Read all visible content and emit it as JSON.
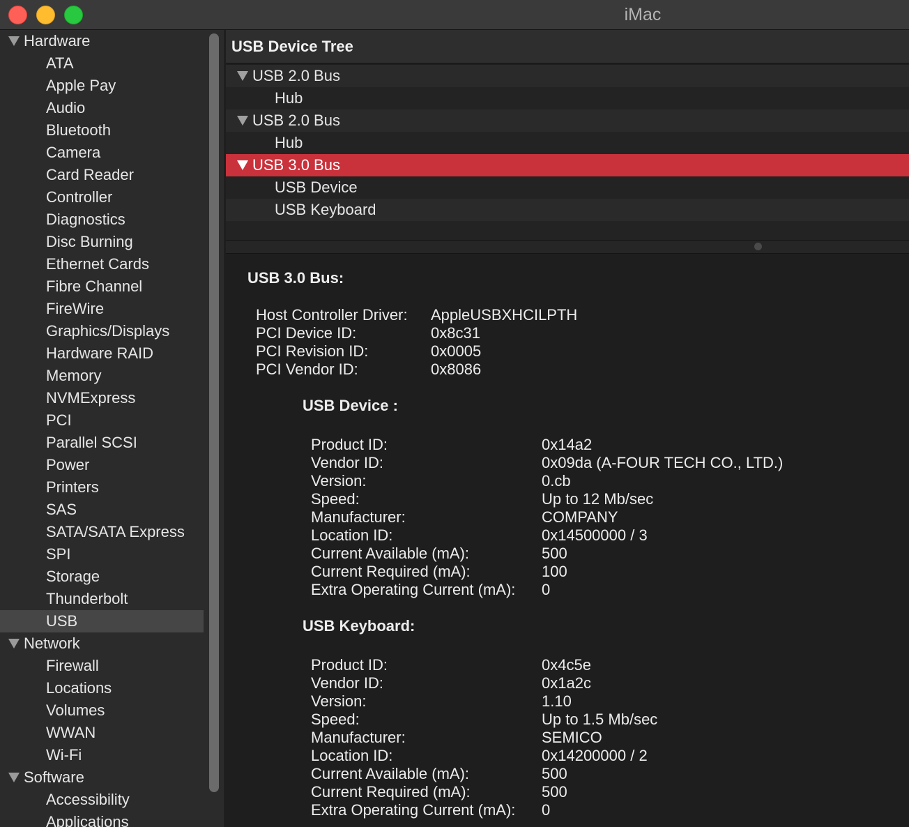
{
  "window": {
    "title": "iMac"
  },
  "sidebar": {
    "groups": [
      {
        "label": "Hardware",
        "items": [
          "ATA",
          "Apple Pay",
          "Audio",
          "Bluetooth",
          "Camera",
          "Card Reader",
          "Controller",
          "Diagnostics",
          "Disc Burning",
          "Ethernet Cards",
          "Fibre Channel",
          "FireWire",
          "Graphics/Displays",
          "Hardware RAID",
          "Memory",
          "NVMExpress",
          "PCI",
          "Parallel SCSI",
          "Power",
          "Printers",
          "SAS",
          "SATA/SATA Express",
          "SPI",
          "Storage",
          "Thunderbolt",
          "USB"
        ]
      },
      {
        "label": "Network",
        "items": [
          "Firewall",
          "Locations",
          "Volumes",
          "WWAN",
          "Wi-Fi"
        ]
      },
      {
        "label": "Software",
        "items": [
          "Accessibility",
          "Applications"
        ]
      }
    ],
    "selected": "USB"
  },
  "tree": {
    "header": "USB Device Tree",
    "rows": [
      {
        "label": "USB 2.0 Bus",
        "type": "bus"
      },
      {
        "label": "Hub",
        "type": "child"
      },
      {
        "label": "USB 2.0 Bus",
        "type": "bus"
      },
      {
        "label": "Hub",
        "type": "child"
      },
      {
        "label": "USB 3.0 Bus",
        "type": "bus",
        "selected": true
      },
      {
        "label": "USB Device",
        "type": "child"
      },
      {
        "label": "USB Keyboard",
        "type": "child"
      }
    ]
  },
  "detail": {
    "title": "USB 3.0 Bus:",
    "bus_props": [
      {
        "key": "Host Controller Driver:",
        "value": "AppleUSBXHCILPTH"
      },
      {
        "key": "PCI Device ID:",
        "value": "0x8c31"
      },
      {
        "key": "PCI Revision ID:",
        "value": "0x0005"
      },
      {
        "key": "PCI Vendor ID:",
        "value": "0x8086"
      }
    ],
    "devices": [
      {
        "title": "USB Device :",
        "props": [
          {
            "key": "Product ID:",
            "value": "0x14a2"
          },
          {
            "key": "Vendor ID:",
            "value": "0x09da  (A-FOUR TECH CO., LTD.)"
          },
          {
            "key": "Version:",
            "value": "0.cb"
          },
          {
            "key": "Speed:",
            "value": "Up to 12 Mb/sec"
          },
          {
            "key": "Manufacturer:",
            "value": "COMPANY"
          },
          {
            "key": "Location ID:",
            "value": "0x14500000 / 3"
          },
          {
            "key": "Current Available (mA):",
            "value": "500"
          },
          {
            "key": "Current Required (mA):",
            "value": "100"
          },
          {
            "key": "Extra Operating Current (mA):",
            "value": "0"
          }
        ]
      },
      {
        "title": "USB Keyboard:",
        "props": [
          {
            "key": "Product ID:",
            "value": "0x4c5e"
          },
          {
            "key": "Vendor ID:",
            "value": "0x1a2c"
          },
          {
            "key": "Version:",
            "value": "1.10"
          },
          {
            "key": "Speed:",
            "value": "Up to 1.5 Mb/sec"
          },
          {
            "key": "Manufacturer:",
            "value": "SEMICO"
          },
          {
            "key": "Location ID:",
            "value": "0x14200000 / 2"
          },
          {
            "key": "Current Available (mA):",
            "value": "500"
          },
          {
            "key": "Current Required (mA):",
            "value": "500"
          },
          {
            "key": "Extra Operating Current (mA):",
            "value": "0"
          }
        ]
      }
    ]
  },
  "colors": {
    "selection": "#c9323b",
    "sidebar_bg": "#2b2b2b",
    "detail_bg": "#1e1e1e"
  }
}
